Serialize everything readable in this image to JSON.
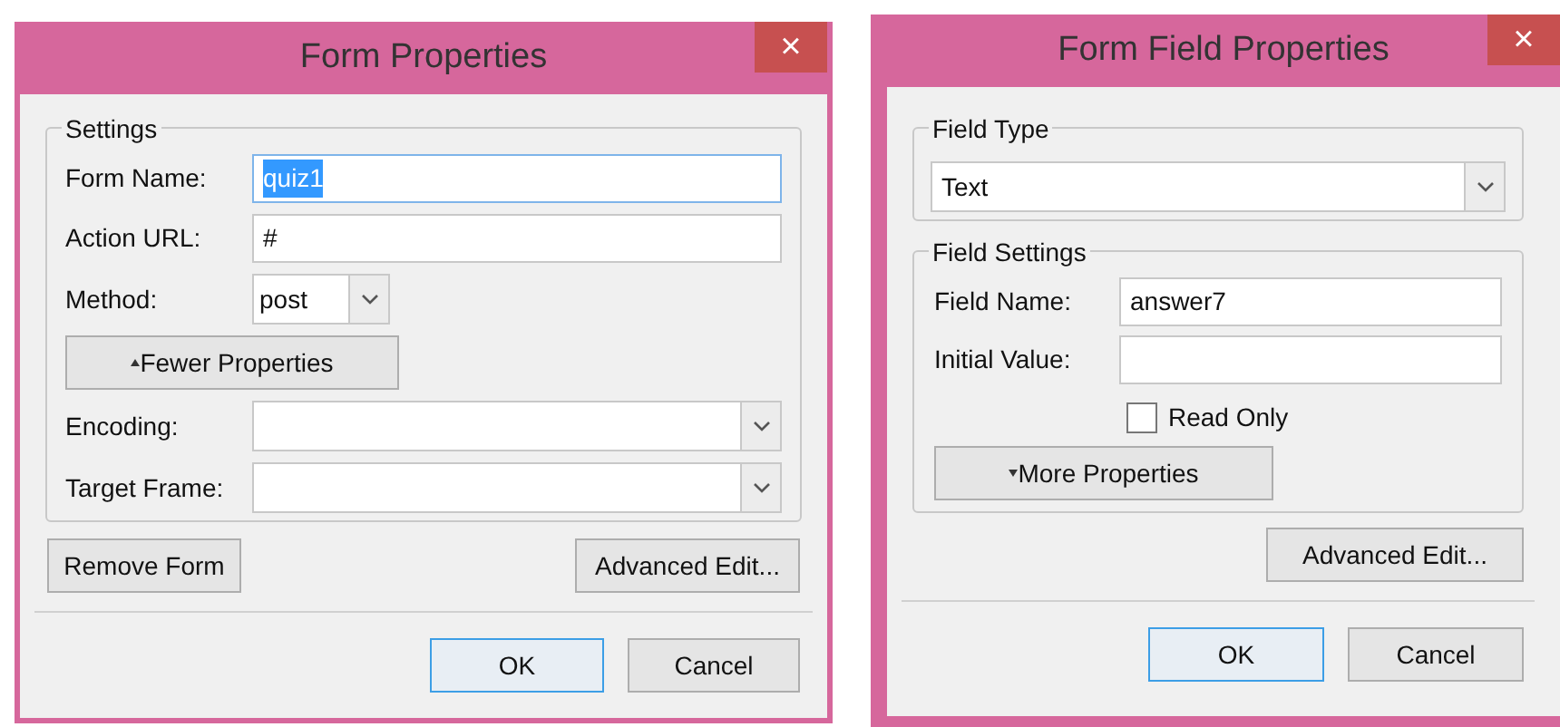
{
  "form_properties": {
    "title": "Form Properties",
    "close": "×",
    "settings": {
      "legend": "Settings",
      "fields": [
        {
          "kind": "text",
          "label": "Form Name:",
          "value": "quiz1",
          "selected": true
        },
        {
          "kind": "text",
          "label": "Action URL:",
          "value": "#",
          "selected": false
        },
        {
          "kind": "short-select",
          "label": "Method:",
          "value": "post"
        }
      ],
      "toggle_button": {
        "label": "Fewer Properties",
        "expanded": true
      },
      "extra_fields": [
        {
          "kind": "select",
          "label": "Encoding:"
        },
        {
          "kind": "select",
          "label": "Target Frame:"
        }
      ]
    },
    "remove_button": {
      "label": "Remove Form"
    },
    "advanced_button": {
      "label": "Advanced Edit..."
    },
    "ok_button": {
      "label": "OK",
      "default": true
    },
    "cancel_button": {
      "label": "Cancel",
      "default": false
    }
  },
  "form_field_properties": {
    "title": "Form Field Properties",
    "close": "×",
    "field_type": {
      "legend": "Field Type",
      "value": "Text"
    },
    "field_settings": {
      "legend": "Field Settings",
      "fields": [
        {
          "kind": "text",
          "label": "Field Name:",
          "value": "answer7",
          "selected": false
        },
        {
          "kind": "text",
          "label": "Initial Value:",
          "selected": false
        }
      ],
      "read_only": {
        "label": "Read Only",
        "checked": false
      },
      "toggle_button": {
        "label": "More Properties",
        "expanded": false
      }
    },
    "advanced_button": {
      "label": "Advanced Edit..."
    },
    "ok_button": {
      "label": "OK",
      "default": true
    },
    "cancel_button": {
      "label": "Cancel",
      "default": false
    }
  }
}
